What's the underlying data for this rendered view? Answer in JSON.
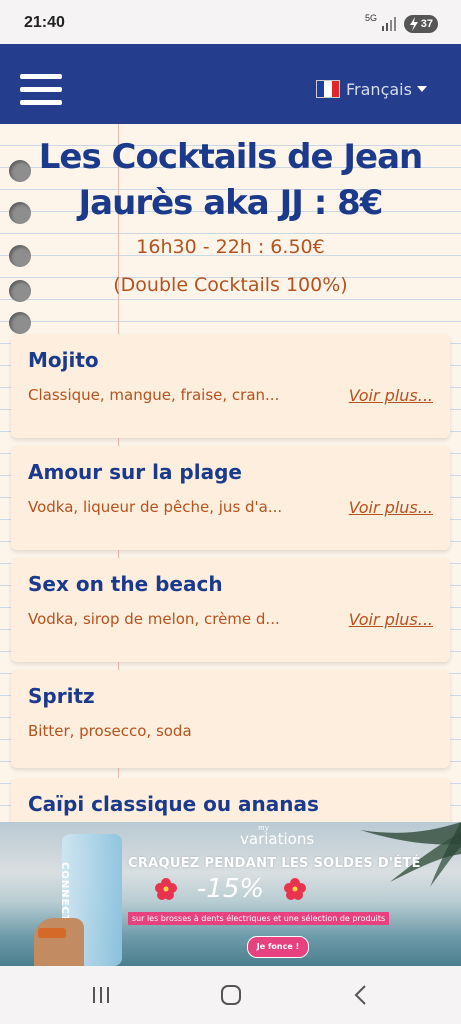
{
  "status_bar": {
    "time": "21:40",
    "network": "5G",
    "battery": "37"
  },
  "header": {
    "language": "Français",
    "language_flag": "france-flag-icon",
    "bar_color": "#243d8c"
  },
  "page": {
    "title": "Les Cocktails de Jean Jaurès aka JJ : 8€",
    "happy_hour": "16h30 - 22h : 6.50€",
    "note": "(Double Cocktails 100%)"
  },
  "cocktails": [
    {
      "name": "Mojito",
      "description": "Classique, mangue, fraise, cran...",
      "more": "Voir plus..."
    },
    {
      "name": "Amour sur la plage",
      "description": "Vodka, liqueur de pêche, jus d'a...",
      "more": "Voir plus..."
    },
    {
      "name": "Sex on the beach",
      "description": "Vodka, sirop de melon, crème d...",
      "more": "Voir plus..."
    },
    {
      "name": "Spritz",
      "description": "Bitter, prosecco, soda",
      "more": ""
    },
    {
      "name": "Caïpi classique ou ananas",
      "description": "",
      "more": ""
    }
  ],
  "ad": {
    "brand_small": "my",
    "brand": "variations",
    "product_text": "CONNECT",
    "headline": "CRAQUEZ PENDANT LES SOLDES D'ÉTÉ",
    "promo": "-15%",
    "note": "sur les brosses à dents électriques et une sélection de produits",
    "cta": "Je fonce !"
  },
  "colors": {
    "title": "#1c3a8c",
    "accent_text": "#b5521e",
    "card_bg": "#fdeedd",
    "ad_pink": "#e7427f"
  }
}
